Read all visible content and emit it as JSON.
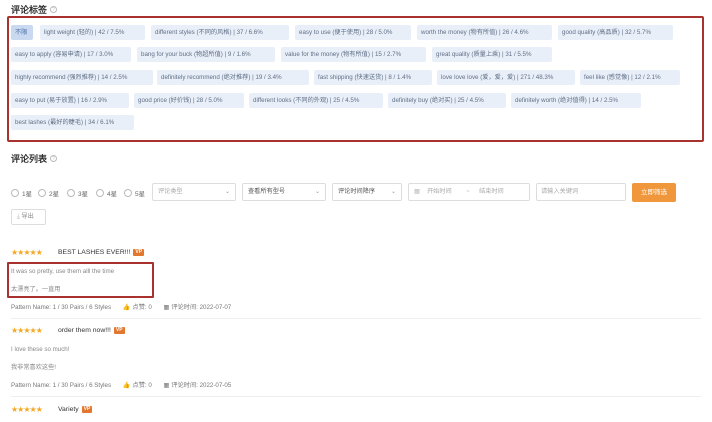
{
  "tags_title": "评论标签",
  "tags": [
    {
      "label": "不限",
      "active": true
    },
    {
      "label": "light weight (轻的) | 42 / 7.5%"
    },
    {
      "label": "different styles (不同的风格) | 37 / 6.6%"
    },
    {
      "label": "easy to use (便于使用) | 28 / 5.0%"
    },
    {
      "label": "worth the money (物有所值) | 26 / 4.6%"
    },
    {
      "label": "good quality (高品质) | 32 / 5.7%"
    },
    {
      "label": "easy to apply (容易申请) | 17 / 3.0%"
    },
    {
      "label": "bang for your buck (物超所值) | 9 / 1.6%"
    },
    {
      "label": "value for the money (物有所值) | 15 / 2.7%"
    },
    {
      "label": "great quality (质量上乘) | 31 / 5.5%"
    },
    {
      "label": "highly recommend (强烈推荐) | 14 / 2.5%"
    },
    {
      "label": "definitely recommend (绝对推荐) | 19 / 3.4%"
    },
    {
      "label": "fast shipping (快速送货) | 8 / 1.4%"
    },
    {
      "label": "love love love (爱，爱，爱) | 271 / 48.3%"
    },
    {
      "label": "feel like (感觉像) | 12 / 2.1%"
    },
    {
      "label": "easy to put (易于放置) | 16 / 2.9%"
    },
    {
      "label": "good price (好价钱) | 28 / 5.0%"
    },
    {
      "label": "different looks (不同的外观) | 25 / 4.5%"
    },
    {
      "label": "definitely buy (绝对买) | 25 / 4.5%"
    },
    {
      "label": "definitely worth (绝对值得) | 14 / 2.5%"
    },
    {
      "label": "best lashes (最好的睫毛) | 34 / 6.1%"
    }
  ],
  "reviews_title": "评论列表",
  "filters": {
    "ratings": [
      "1星",
      "2星",
      "3星",
      "4星",
      "5星"
    ],
    "review_type": "评论类型",
    "model": "查看所有型号",
    "sort": "评论时间降序",
    "start_date": "开始时间",
    "date_sep": "~",
    "end_date": "结束时间",
    "keyword_placeholder": "请输入关键词",
    "submit": "立即筛选",
    "export": "导出"
  },
  "reviews": [
    {
      "rating_stars": "★★★★★",
      "title": "BEST LASHES EVER!!!",
      "badge": "VP",
      "text": "It was so pretty, use them alll the time",
      "translation": "太漂亮了。一直用",
      "pattern": "Pattern Name: 1 / 30 Pairs / 6 Styles",
      "likes": "点赞: 0",
      "time": "评论时间: 2022-07-07"
    },
    {
      "rating_stars": "★★★★★",
      "title": "order them now!!!",
      "badge": "VP",
      "text": "I love these so much!",
      "translation": "我非常喜欢这些!",
      "pattern": "Pattern Name: 1 / 30 Pairs / 6 Styles",
      "likes": "点赞: 0",
      "time": "评论时间: 2022-07-05"
    },
    {
      "rating_stars": "★★★★★",
      "title": "Variety",
      "badge": "VP"
    }
  ]
}
